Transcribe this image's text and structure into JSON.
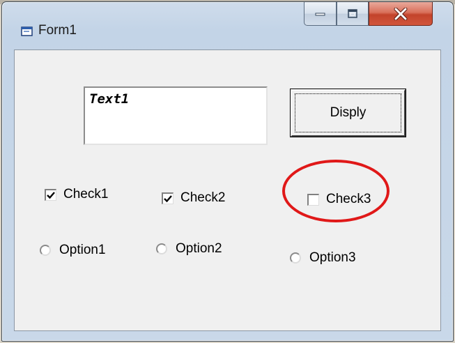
{
  "window": {
    "title": "Form1",
    "controls": [
      "minimize",
      "maximize",
      "close"
    ]
  },
  "form": {
    "textbox_value": "Text1",
    "button_label": "Disply",
    "checkboxes": [
      {
        "label": "Check1",
        "checked": true
      },
      {
        "label": "Check2",
        "checked": true
      },
      {
        "label": "Check3",
        "checked": false
      }
    ],
    "options": [
      {
        "label": "Option1",
        "selected": false
      },
      {
        "label": "Option2",
        "selected": false
      },
      {
        "label": "Option3",
        "selected": false
      }
    ]
  },
  "icons": {
    "app": "form-window-icon",
    "minimize": "minimize-icon",
    "maximize": "maximize-icon",
    "close": "close-icon"
  },
  "colors": {
    "annotation": "#e01818",
    "close_button": "#c3432b",
    "client_bg": "#f0f0f0"
  }
}
